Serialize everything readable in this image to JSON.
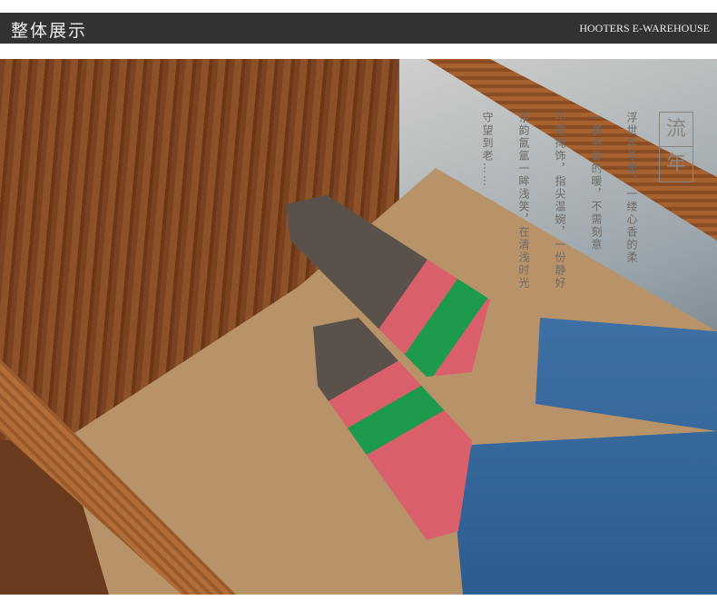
{
  "header": {
    "title": "整体展示",
    "brand": "HOOTERS E-WAREHOUSE"
  },
  "poem": {
    "stamp": [
      "流",
      "年"
    ],
    "columns": [
      "浮世年华里，一缕心香的柔",
      "一袭书香的暖，不需刻意",
      "不需掩饰，指尖温婉，一份静好",
      "茶韵氤氲一眸浅笑，在清浅时光",
      "守望到老……"
    ]
  }
}
